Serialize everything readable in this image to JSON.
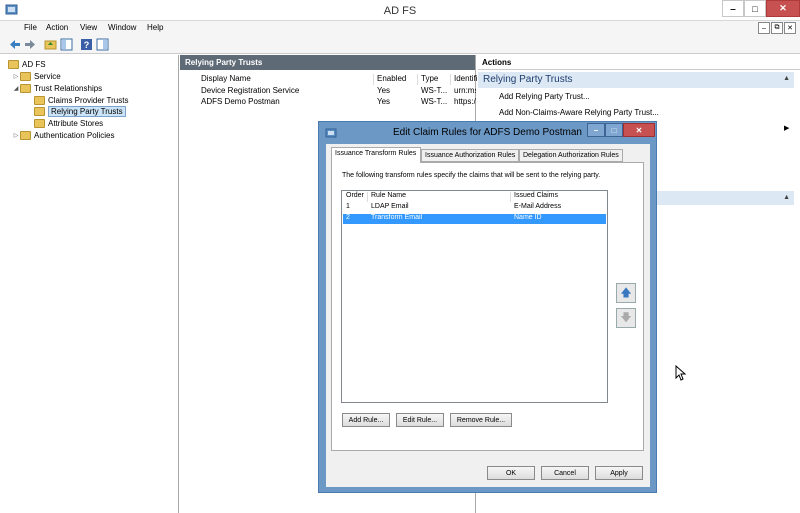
{
  "window": {
    "title": "AD FS",
    "minimize": "‒",
    "maximize": "□",
    "close": "✕"
  },
  "menu": {
    "items": [
      "File",
      "Action",
      "View",
      "Window",
      "Help"
    ],
    "mdi_minimize": "–",
    "mdi_restore": "⧉",
    "mdi_close": "✕"
  },
  "toolbar": {
    "icons": [
      "back-icon",
      "forward-icon",
      "up-folder-icon",
      "show-hide-tree-icon",
      "help-icon",
      "show-hide-action-pane-icon"
    ]
  },
  "tree": {
    "root": "AD FS",
    "items": [
      {
        "label": "Service",
        "expander": "▷"
      },
      {
        "label": "Trust Relationships",
        "expander": "◢"
      },
      {
        "label": "Claims Provider Trusts",
        "expander": ""
      },
      {
        "label": "Relying Party Trusts",
        "expander": ""
      },
      {
        "label": "Attribute Stores",
        "expander": ""
      },
      {
        "label": "Authentication Policies",
        "expander": "▷"
      }
    ]
  },
  "center": {
    "title": "Relying Party Trusts",
    "columns": [
      "Display Name",
      "Enabled",
      "Type",
      "Identifi"
    ],
    "rows": [
      [
        "Device Registration Service",
        "Yes",
        "WS-T...",
        "urn:ms"
      ],
      [
        "ADFS Demo Postman",
        "Yes",
        "WS-T...",
        "https:/"
      ]
    ]
  },
  "actions": {
    "title": "Actions",
    "section": "Relying Party Trusts",
    "links": [
      "Add Relying Party Trust...",
      "Add Non-Claims-Aware Relying Party Trust..."
    ],
    "collapse": "▲",
    "submenu_arrow": "▶"
  },
  "dialog": {
    "title": "Edit Claim Rules for ADFS Demo Postman",
    "minimize": "–",
    "maximize": "□",
    "close": "✕",
    "tabs": [
      "Issuance Transform Rules",
      "Issuance Authorization Rules",
      "Delegation Authorization Rules"
    ],
    "description": "The following transform rules specify the claims that will be sent to the relying party.",
    "columns": [
      "Order",
      "Rule Name",
      "Issued Claims"
    ],
    "rules": [
      {
        "order": "1",
        "name": "LDAP Email",
        "claims": "E-Mail Address"
      },
      {
        "order": "2",
        "name": "Transform Email",
        "claims": "Name ID"
      }
    ],
    "move_up": "🡅",
    "move_down": "🡇",
    "add_rule": "Add Rule...",
    "edit_rule": "Edit Rule...",
    "remove_rule": "Remove Rule...",
    "ok": "OK",
    "cancel": "Cancel",
    "apply": "Apply"
  },
  "colors": {
    "dialog_frame": "#6c98c6",
    "selection": "#3399ff",
    "pane_header": "#5f6a77",
    "action_section": "#dde8f5"
  }
}
